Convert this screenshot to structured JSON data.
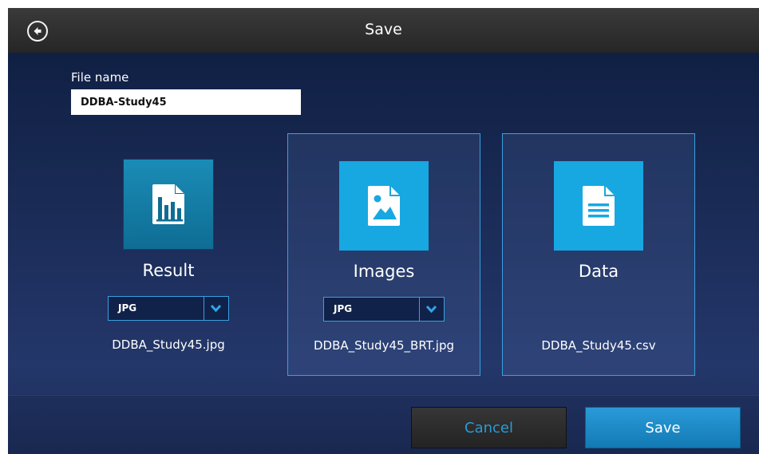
{
  "header": {
    "title": "Save",
    "back_icon": "back-arrow-icon"
  },
  "file_name": {
    "label": "File name",
    "value": "DDBA-Study45"
  },
  "cards": [
    {
      "title": "Result",
      "icon": "bar-chart-document-icon",
      "format": "JPG",
      "filename": "DDBA_Study45.jpg",
      "selected": false
    },
    {
      "title": "Images",
      "icon": "image-document-icon",
      "format": "JPG",
      "filename": "DDBA_Study45_BRT.jpg",
      "selected": true
    },
    {
      "title": "Data",
      "icon": "text-document-icon",
      "filename": "DDBA_Study45.csv",
      "selected": true
    }
  ],
  "footer": {
    "cancel_label": "Cancel",
    "save_label": "Save"
  },
  "colors": {
    "accent": "#17a8e2",
    "selection_border": "#3a9fe0",
    "cancel_text": "#2a9bd6"
  }
}
